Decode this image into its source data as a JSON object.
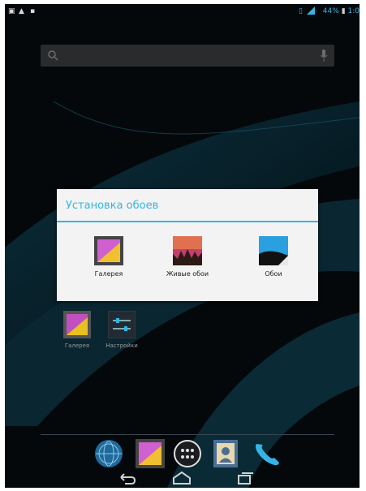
{
  "statusbar": {
    "battery_percent": "44%",
    "time": "1:0",
    "icons": [
      "screenshot-icon",
      "warning-icon",
      "lock-icon",
      "vibrate-icon",
      "signal-icon",
      "battery-icon"
    ]
  },
  "search": {
    "icon": "search-icon",
    "mic": "mic-icon"
  },
  "dialog": {
    "title": "Установка обоев",
    "options": [
      {
        "label": "Галерея",
        "icon": "gallery-icon"
      },
      {
        "label": "Живые обои",
        "icon": "live-wallpapers-icon"
      },
      {
        "label": "Обои",
        "icon": "wallpapers-icon"
      }
    ]
  },
  "home": {
    "shortcuts": [
      {
        "label": "Галерея",
        "icon": "gallery-icon"
      },
      {
        "label": "Настройки",
        "icon": "settings-icon"
      }
    ]
  },
  "dock": [
    "browser-icon",
    "gallery-icon",
    "all-apps-icon",
    "contacts-icon",
    "phone-icon"
  ],
  "navbar": [
    "back-icon",
    "home-icon",
    "recent-apps-icon"
  ],
  "colors": {
    "accent": "#33b5e5",
    "dialog_bg": "#f3f3f3",
    "screen_bg": "#05070a"
  }
}
